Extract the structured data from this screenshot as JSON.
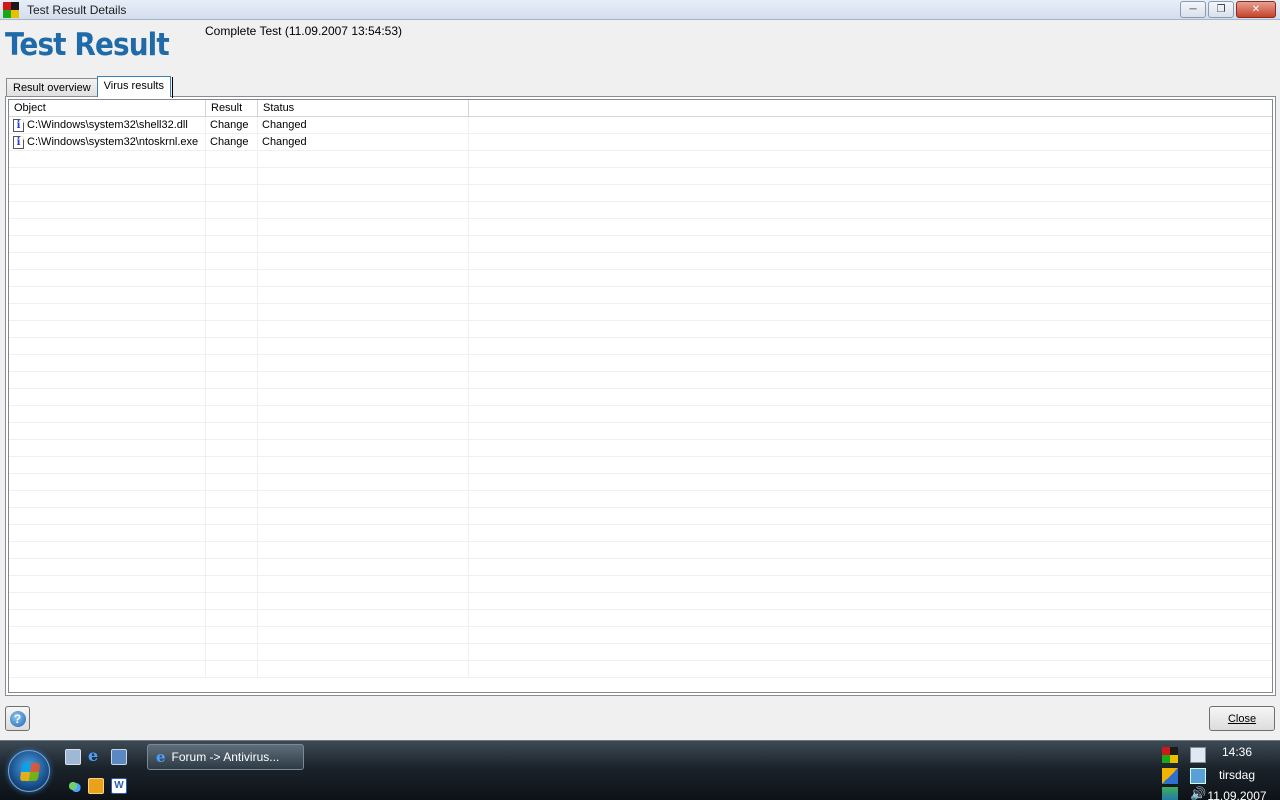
{
  "window": {
    "title": "Test Result Details",
    "min_symbol": "─",
    "max_symbol": "❐",
    "close_symbol": "✕"
  },
  "header": {
    "title": "Test Result",
    "subtitle": "Complete Test (11.09.2007 13:54:53)"
  },
  "tabs": [
    {
      "label": "Result overview",
      "active": false
    },
    {
      "label": "Virus results",
      "active": true
    }
  ],
  "table": {
    "columns": [
      "Object",
      "Result",
      "Status"
    ],
    "rows": [
      {
        "object": "C:\\Windows\\system32\\shell32.dll",
        "result": "Change",
        "status": "Changed",
        "icon": "info-icon"
      },
      {
        "object": "C:\\Windows\\system32\\ntoskrnl.exe",
        "result": "Change",
        "status": "Changed",
        "icon": "info-icon"
      }
    ]
  },
  "footer": {
    "help_symbol": "?",
    "close_label": "Close"
  },
  "taskbar": {
    "task_label": "Forum -> Antivirus...",
    "ie_symbol": "e",
    "word_symbol": "W",
    "volume_symbol": "🔊",
    "clock_time": "14:36",
    "clock_day": "tirsdag",
    "clock_date": "11.09.2007"
  }
}
